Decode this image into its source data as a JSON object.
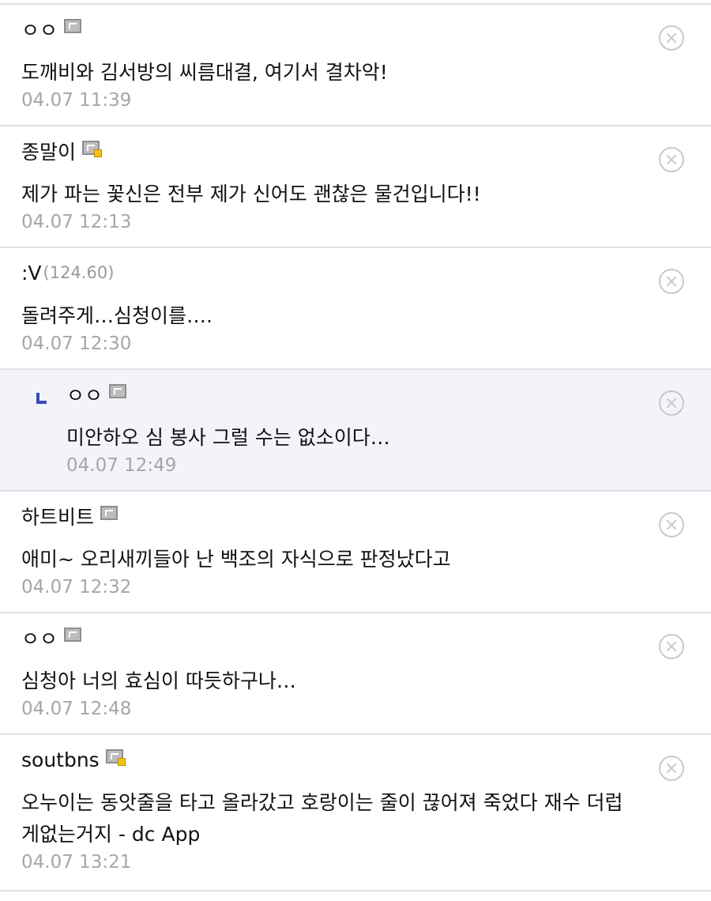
{
  "comments": [
    {
      "nick": "ㅇㅇ",
      "ip": "",
      "badge": "gonic",
      "text": "도깨비와 김서방의 씨름대결, 여기서 결차악!",
      "time": "04.07 11:39",
      "reply": false
    },
    {
      "nick": "종말이",
      "ip": "",
      "badge": "half-gonic",
      "text": "제가 파는 꽃신은 전부 제가 신어도 괜찮은 물건입니다!!",
      "time": "04.07 12:13",
      "reply": false
    },
    {
      "nick": ":V",
      "ip": "(124.60)",
      "badge": "",
      "text": "돌려주게…심청이를….",
      "time": "04.07 12:30",
      "reply": false
    },
    {
      "nick": "ㅇㅇ",
      "ip": "",
      "badge": "gonic",
      "text": "미안하오 심 봉사 그럴 수는 없소이다…",
      "time": "04.07 12:49",
      "reply": true
    },
    {
      "nick": "하트비트",
      "ip": "",
      "badge": "gonic",
      "text": "애미~ 오리새끼들아 난 백조의 자식으로 판정났다고",
      "time": "04.07 12:32",
      "reply": false
    },
    {
      "nick": "ㅇㅇ",
      "ip": "",
      "badge": "gonic",
      "text": "심청아 너의 효심이 따듯하구나…",
      "time": "04.07 12:48",
      "reply": false
    },
    {
      "nick": "soutbns",
      "ip": "",
      "badge": "half-gonic",
      "text": "오누이는 동앗줄을 타고 올라갔고 호랑이는 줄이 끊어져 죽었다 재수 더럽게없는거지 - dc App",
      "time": "04.07 13:21",
      "reply": false
    }
  ],
  "icons": {
    "delete": "close-circle-icon",
    "reply": "reply-arrow-icon",
    "badge": "fixed-nick-badge-icon"
  },
  "colors": {
    "reply_bg": "#f3f4f9",
    "reply_mark": "#3b4bb8",
    "timestamp": "#a6a6a6",
    "divider": "#e0e0e8"
  }
}
